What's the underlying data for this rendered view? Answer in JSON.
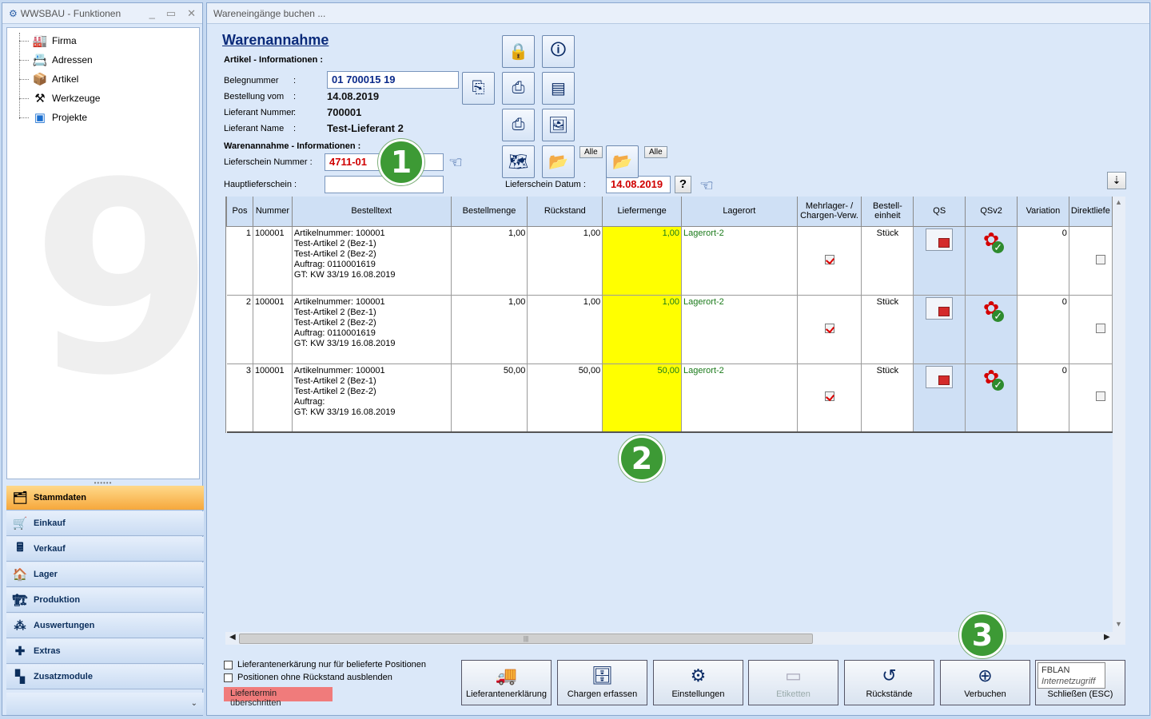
{
  "left_window": {
    "title": "WWSBAU - Funktionen",
    "title_buttons": [
      "_",
      "▭",
      "✕"
    ],
    "tree": [
      {
        "label": "Firma",
        "icon": "factory-icon"
      },
      {
        "label": "Adressen",
        "icon": "address-card-icon"
      },
      {
        "label": "Artikel",
        "icon": "box-icon"
      },
      {
        "label": "Werkzeuge",
        "icon": "tools-icon"
      },
      {
        "label": "Projekte",
        "icon": "project-icon"
      }
    ],
    "nav": [
      {
        "label": "Stammdaten",
        "icon": "stammdaten-icon",
        "active": true
      },
      {
        "label": "Einkauf",
        "icon": "cart-icon"
      },
      {
        "label": "Verkauf",
        "icon": "cash-register-icon"
      },
      {
        "label": "Lager",
        "icon": "warehouse-icon"
      },
      {
        "label": "Produktion",
        "icon": "production-icon"
      },
      {
        "label": "Auswertungen",
        "icon": "analytics-icon"
      },
      {
        "label": "Extras",
        "icon": "extras-icon"
      },
      {
        "label": "Zusatzmodule",
        "icon": "modules-icon"
      }
    ],
    "nav_footer": "⌄"
  },
  "main_window": {
    "title": "Wareneingänge buchen ...",
    "heading": "Warenannahme",
    "artikel_section": "Artikel - Informationen :",
    "fields": {
      "belegnummer_label": "Belegnummer",
      "belegnummer_value": "01 700015 19",
      "bestellung_label": "Bestellung vom",
      "bestellung_value": "14.08.2019",
      "lieferant_nr_label": "Lieferant Nummer",
      "lieferant_nr_value": "700001",
      "lieferant_name_label": "Lieferant Name",
      "lieferant_name_value": "Test-Lieferant 2",
      "colon": ":"
    },
    "warenannahme_section": "Warenannahme - Informationen :",
    "lieferschein_nr_label": "Lieferschein Nummer :",
    "lieferschein_nr_value": "4711-01",
    "hauptlieferschein_label": "Hauptlieferschein :",
    "hauptlieferschein_value": "",
    "lieferschein_datum_label": "Lieferschein Datum :",
    "lieferschein_datum_value": "14.08.2019",
    "alle_label": "Alle",
    "help_label": "?",
    "markers": [
      "1",
      "2",
      "3"
    ]
  },
  "grid": {
    "columns": [
      "Pos",
      "Nummer",
      "Bestelltext",
      "Bestellmenge",
      "Rückstand",
      "Liefermenge",
      "Lagerort",
      "Mehrlager- / Chargen-Verw.",
      "Bestell-einheit",
      "QS",
      "QSv2",
      "Variation",
      "Direktliefe"
    ],
    "rows": [
      {
        "pos": "1",
        "nummer": "100001",
        "text": [
          "Artikelnummer: 100001",
          "Test-Artikel 2  (Bez-1)",
          "Test-Artikel 2  (Bez-2)",
          "Auftrag: 0110001619",
          "GT: KW 33/19   16.08.2019"
        ],
        "bestellmenge": "1,00",
        "rueckstand": "1,00",
        "liefermenge": "1,00",
        "lagerort": "Lagerort-2",
        "mehrlager": true,
        "einheit": "Stück",
        "variation": "0"
      },
      {
        "pos": "2",
        "nummer": "100001",
        "text": [
          "Artikelnummer: 100001",
          "Test-Artikel 2  (Bez-1)",
          "Test-Artikel 2  (Bez-2)",
          "Auftrag: 0110001619",
          "GT: KW 33/19   16.08.2019"
        ],
        "bestellmenge": "1,00",
        "rueckstand": "1,00",
        "liefermenge": "1,00",
        "lagerort": "Lagerort-2",
        "mehrlager": true,
        "einheit": "Stück",
        "variation": "0"
      },
      {
        "pos": "3",
        "nummer": "100001",
        "text": [
          "Artikelnummer: 100001",
          "Test-Artikel 2  (Bez-1)",
          "Test-Artikel 2  (Bez-2)",
          "Auftrag:",
          "GT: KW 33/19   16.08.2019"
        ],
        "bestellmenge": "50,00",
        "rueckstand": "50,00",
        "liefermenge": "50,00",
        "lagerort": "Lagerort-2",
        "mehrlager": true,
        "einheit": "Stück",
        "variation": "0"
      }
    ]
  },
  "bottom": {
    "checkbox1": "Lieferantenerkärung nur für belieferte Positionen",
    "checkbox2": "Positionen ohne Rückstand ausblenden",
    "red_label": "Liefertermin überschritten",
    "buttons": [
      {
        "label": "Lieferantenerklärung",
        "icon": "truck-icon"
      },
      {
        "label": "Chargen erfassen",
        "icon": "chargen-icon"
      },
      {
        "label": "Einstellungen",
        "icon": "gears-icon"
      },
      {
        "label": "Etiketten",
        "icon": "label-icon",
        "disabled": true
      },
      {
        "label": "Rückstände",
        "icon": "history-icon"
      },
      {
        "label": "Verbuchen",
        "icon": "box-plus-icon"
      },
      {
        "label": "Schließen (ESC)",
        "icon": "close-icon"
      }
    ],
    "tooltip_line1": "FBLAN",
    "tooltip_line2": "Internetzugriff"
  }
}
